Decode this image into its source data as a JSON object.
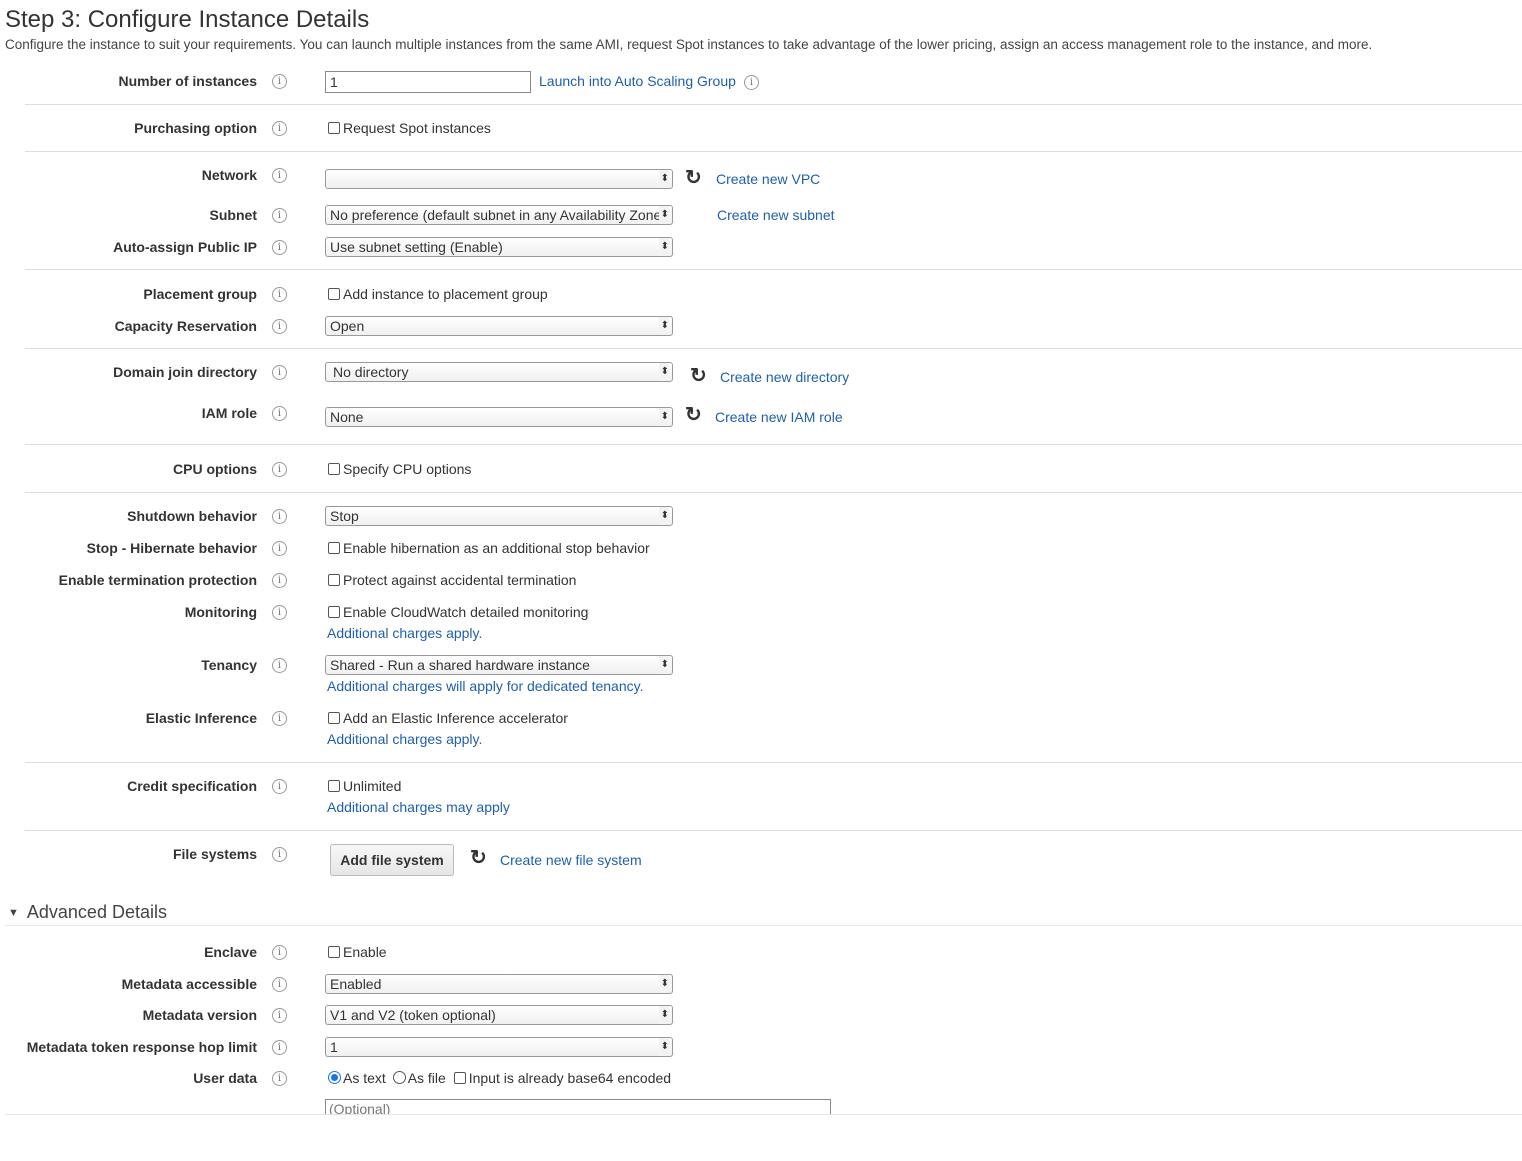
{
  "header": {
    "title": "Step 3: Configure Instance Details",
    "description": "Configure the instance to suit your requirements. You can launch multiple instances from the same AMI, request Spot instances to take advantage of the lower pricing, assign an access management role to the instance, and more."
  },
  "info_glyph": "i",
  "refresh_glyph": "↻",
  "select_arrow": "⬍",
  "fields": {
    "number_of_instances": {
      "label": "Number of instances",
      "value": "1",
      "link": "Launch into Auto Scaling Group"
    },
    "purchasing_option": {
      "label": "Purchasing option",
      "checkbox": "Request Spot instances",
      "checked": false
    },
    "network": {
      "label": "Network",
      "value": "",
      "link": "Create new VPC"
    },
    "subnet": {
      "label": "Subnet",
      "value": "No preference (default subnet in any Availability Zone)",
      "link": "Create new subnet"
    },
    "auto_assign_ip": {
      "label": "Auto-assign Public IP",
      "value": "Use subnet setting (Enable)"
    },
    "placement_group": {
      "label": "Placement group",
      "checkbox": "Add instance to placement group",
      "checked": false
    },
    "capacity_reservation": {
      "label": "Capacity Reservation",
      "value": "Open"
    },
    "domain_join": {
      "label": "Domain join directory",
      "value": "No directory",
      "link": "Create new directory"
    },
    "iam_role": {
      "label": "IAM role",
      "value": "None",
      "link": "Create new IAM role"
    },
    "cpu_options": {
      "label": "CPU options",
      "checkbox": "Specify CPU options",
      "checked": false
    },
    "shutdown_behavior": {
      "label": "Shutdown behavior",
      "value": "Stop"
    },
    "hibernate": {
      "label": "Stop - Hibernate behavior",
      "checkbox": "Enable hibernation as an additional stop behavior",
      "checked": false
    },
    "termination_protection": {
      "label": "Enable termination protection",
      "checkbox": "Protect against accidental termination",
      "checked": false
    },
    "monitoring": {
      "label": "Monitoring",
      "checkbox": "Enable CloudWatch detailed monitoring",
      "checked": false,
      "note": "Additional charges apply."
    },
    "tenancy": {
      "label": "Tenancy",
      "value": "Shared - Run a shared hardware instance",
      "note": "Additional charges will apply for dedicated tenancy."
    },
    "elastic_inference": {
      "label": "Elastic Inference",
      "checkbox": "Add an Elastic Inference accelerator",
      "checked": false,
      "note": "Additional charges apply."
    },
    "credit_specification": {
      "label": "Credit specification",
      "checkbox": "Unlimited",
      "checked": false,
      "note": "Additional charges may apply"
    },
    "file_systems": {
      "label": "File systems",
      "button": "Add file system",
      "link": "Create new file system"
    }
  },
  "advanced": {
    "title": "Advanced Details",
    "enclave": {
      "label": "Enclave",
      "checkbox": "Enable",
      "checked": false
    },
    "metadata_accessible": {
      "label": "Metadata accessible",
      "value": "Enabled"
    },
    "metadata_version": {
      "label": "Metadata version",
      "value": "V1 and V2 (token optional)"
    },
    "hop_limit": {
      "label": "Metadata token response hop limit",
      "value": "1"
    },
    "user_data": {
      "label": "User data",
      "radio_text": "As text",
      "radio_file": "As file",
      "selected": "As text",
      "base64_checkbox": "Input is already base64 encoded",
      "placeholder": "(Optional)"
    }
  }
}
